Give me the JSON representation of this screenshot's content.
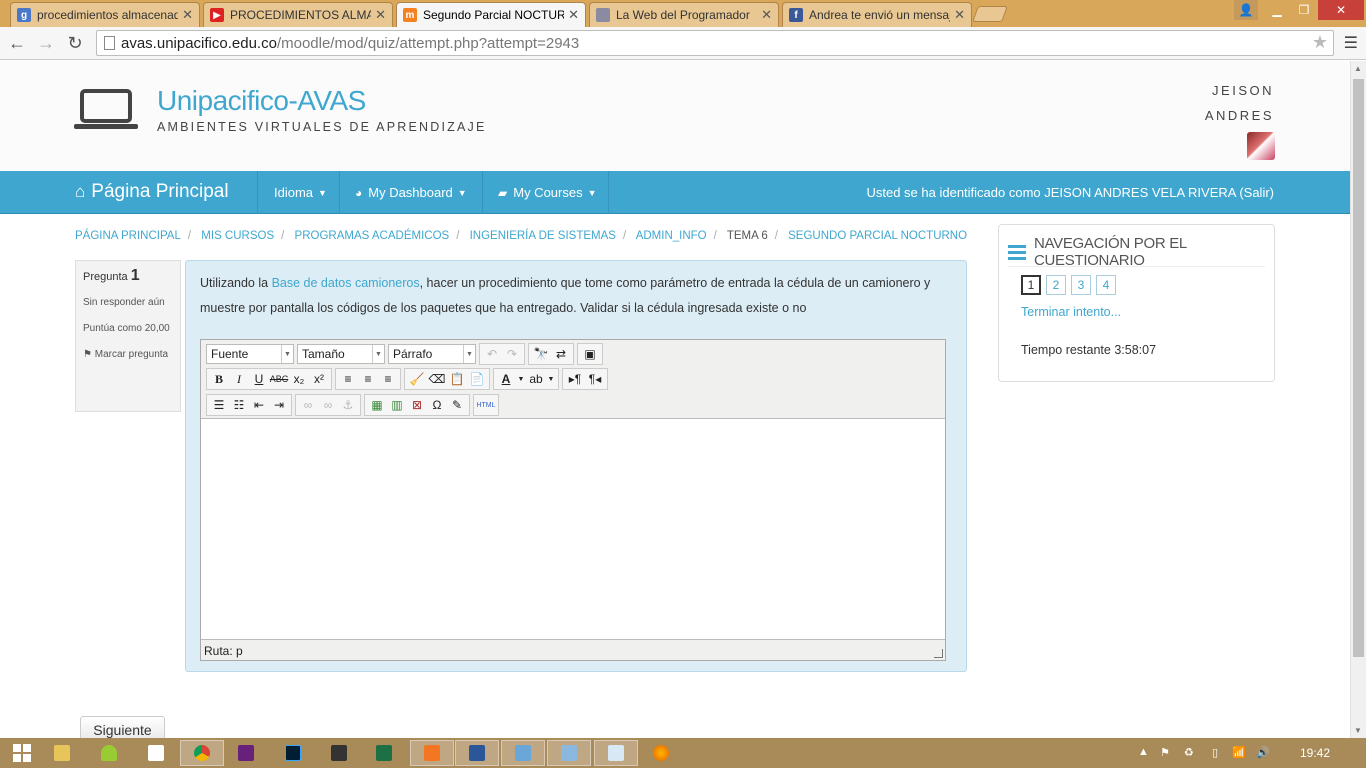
{
  "browser": {
    "tabs": [
      {
        "title": "procedimientos almacenados",
        "favicon": "google-icon",
        "color": "#4a78c8"
      },
      {
        "title": "PROCEDIMIENTOS ALMACENADOS",
        "favicon": "youtube-icon",
        "color": "#d22"
      },
      {
        "title": "Segundo Parcial NOCTURNO",
        "favicon": "moodle-icon",
        "color": "#f58220"
      },
      {
        "title": "La Web del Programador",
        "favicon": "page-icon",
        "color": "#8a8aa0"
      },
      {
        "title": "Andrea te envió un mensaje",
        "favicon": "facebook-icon",
        "color": "#3b5998"
      }
    ],
    "url_domain": "avas.unipacifico.edu.co",
    "url_path": "/moodle/mod/quiz/attempt.php?attempt=2943"
  },
  "site": {
    "name": "Unipacifico-AVAS",
    "tagline": "AMBIENTES VIRTUALES DE APRENDIZAJE",
    "user_first": "JEISON",
    "user_second": "ANDRES"
  },
  "navbar": {
    "home": "Página Principal",
    "idioma": "Idioma",
    "dashboard": "My Dashboard",
    "courses": "My Courses",
    "login_text": "Usted se ha identificado como JEISON ANDRES VELA RIVERA (Salir)"
  },
  "breadcrumb": [
    "PÁGINA PRINCIPAL",
    "MIS CURSOS",
    "PROGRAMAS ACADÉMICOS",
    "INGENIERÍA DE SISTEMAS",
    "ADMIN_INFO",
    "TEMA 6",
    "SEGUNDO PARCIAL NOCTURNO"
  ],
  "question": {
    "label": "Pregunta",
    "number": "1",
    "status": "Sin responder aún",
    "points": "Puntúa como 20,00",
    "flag": "Marcar pregunta",
    "text_before": "Utilizando la ",
    "link": "Base de datos camioneros",
    "text_after": ", hacer un procedimiento que tome como parámetro de entrada la cédula de un camionero y muestre por pantalla los códigos de los paquetes que ha entregado. Validar si la cédula ingresada existe o no"
  },
  "editor": {
    "font": "Fuente",
    "size": "Tamaño",
    "format": "Párrafo",
    "path": "Ruta: p"
  },
  "next_button": "Siguiente",
  "quiz_nav": {
    "title": "NAVEGACIÓN POR EL CUESTIONARIO",
    "numbers": [
      "1",
      "2",
      "3",
      "4"
    ],
    "finish": "Terminar intento...",
    "time_label": "Tiempo restante",
    "time_value": "3:58:07"
  },
  "taskbar": {
    "clock": "19:42"
  }
}
